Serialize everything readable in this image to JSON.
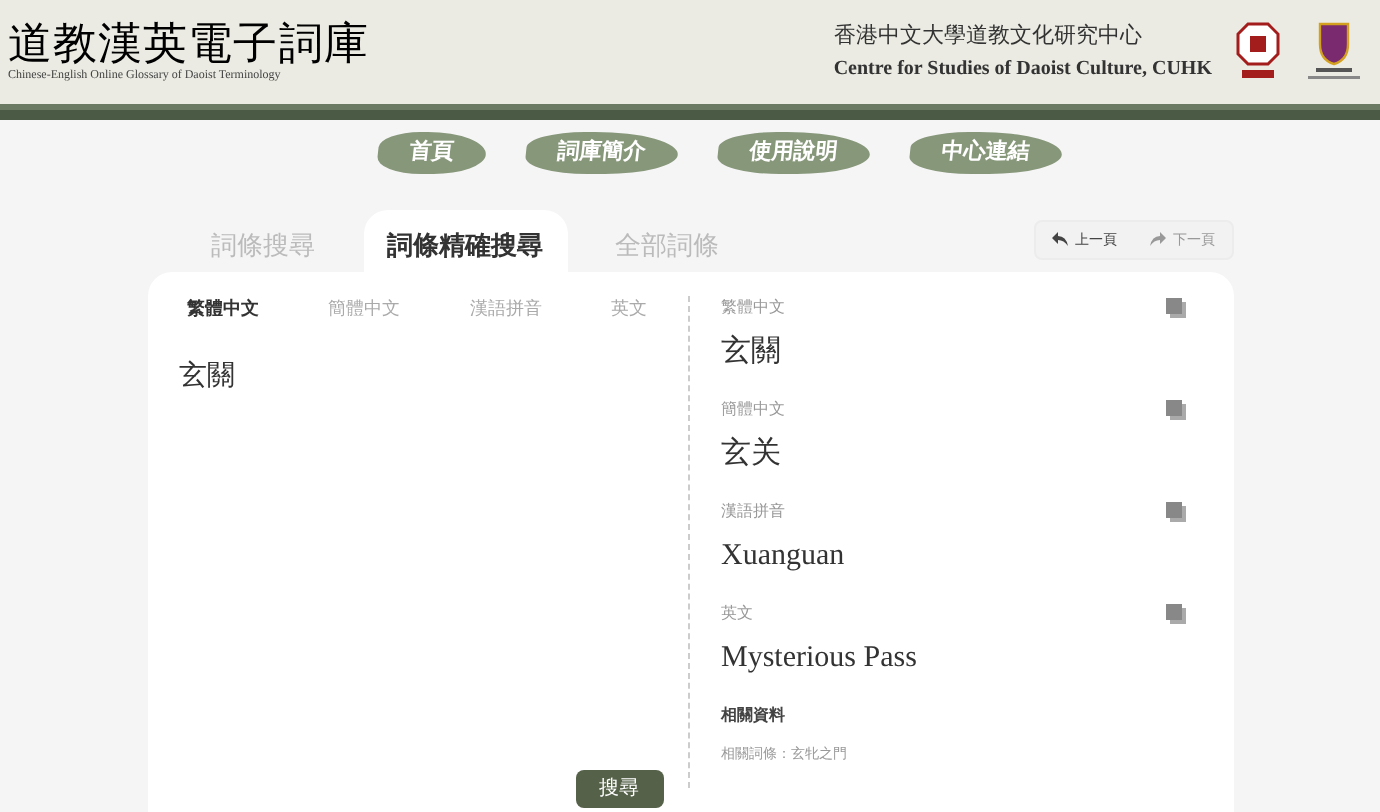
{
  "header": {
    "title": "道教漢英電子詞庫",
    "subtitle": "Chinese-English Online Glossary of Daoist Terminology",
    "centre_zh": "香港中文大學道教文化研究中心",
    "centre_en": "Centre for Studies of Daoist Culture, CUHK"
  },
  "nav": [
    "首頁",
    "詞庫簡介",
    "使用說明",
    "中心連結"
  ],
  "tabs": [
    {
      "label": "詞條搜尋",
      "selected": false
    },
    {
      "label": "詞條精確搜尋",
      "selected": true
    },
    {
      "label": "全部詞條",
      "selected": false
    }
  ],
  "pager": [
    {
      "label": "上一頁",
      "disabled": false
    },
    {
      "label": "下一頁",
      "disabled": true
    }
  ],
  "input_tabs": [
    {
      "label": "繁體中文",
      "selected": true
    },
    {
      "label": "簡體中文",
      "selected": false
    },
    {
      "label": "漢語拼音",
      "selected": false
    },
    {
      "label": "英文",
      "selected": false
    }
  ],
  "query": "玄關",
  "submit": "搜尋",
  "results": [
    {
      "label": "繁體中文",
      "value": "玄關"
    },
    {
      "label": "簡體中文",
      "value": "玄关"
    },
    {
      "label": "漢語拼音",
      "value": "Xuanguan"
    },
    {
      "label": "英文",
      "value": "Mysterious Pass"
    }
  ],
  "related": {
    "heading": "相關資料",
    "text": "相關詞條：玄牝之門"
  }
}
